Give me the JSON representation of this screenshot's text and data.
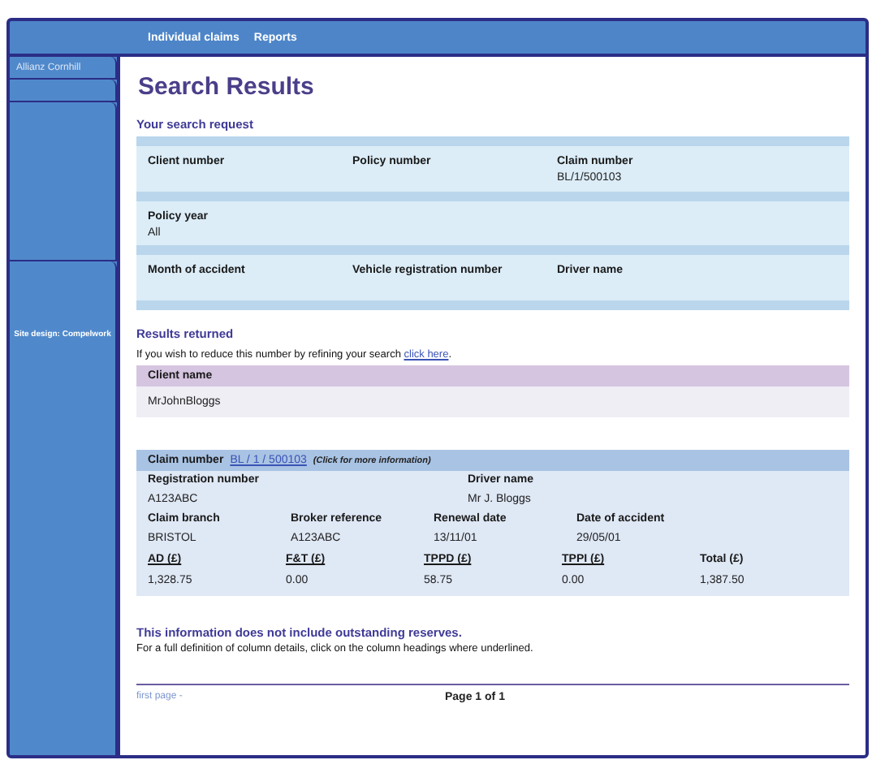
{
  "nav": [
    "Individual claims",
    "Reports"
  ],
  "sidebar": {
    "brand": "Allianz Cornhill",
    "credit": "Site design: Compelwork"
  },
  "title": "Search Results",
  "search_request": {
    "title": "Your search request",
    "rows": [
      [
        {
          "label": "Client number"
        },
        {
          "label": "Policy number"
        },
        {
          "label": "Claim number",
          "value": "BL/1/500103"
        }
      ],
      [
        {
          "label": "Policy year",
          "value": "All"
        }
      ],
      [
        {
          "label": "Month of accident"
        },
        {
          "label": "Vehicle registration number"
        },
        {
          "label": "Driver name"
        }
      ]
    ]
  },
  "results": {
    "title": "Results returned",
    "note": "If you wish to reduce this number by refining your search",
    "note_link": "click here",
    "note_end": ".",
    "client_header": "Client name",
    "client_name": "MrJohnBloggs"
  },
  "claim": {
    "label": "Claim number",
    "link": "BL / 1 / 500103",
    "hint": "(Click for more information)",
    "fields": [
      [
        {
          "label": "Registration number",
          "value": "A123ABC"
        },
        {
          "label": "Driver name",
          "value": "Mr J. Bloggs"
        }
      ],
      [
        {
          "label": "Claim branch",
          "value": "BRISTOL"
        },
        {
          "label": "Broker reference",
          "value": "A123ABC"
        },
        {
          "label": "Renewal date",
          "value": "13/11/01"
        },
        {
          "label": "Date of accident",
          "value": "29/05/01"
        }
      ]
    ],
    "amounts": [
      {
        "label": "AD (£)",
        "value": "1,328.75",
        "underlined": true
      },
      {
        "label": "F&T (£)",
        "value": "0.00",
        "underlined": true
      },
      {
        "label": "TPPD (£)",
        "value": "58.75",
        "underlined": true
      },
      {
        "label": "TPPI (£)",
        "value": "0.00",
        "underlined": true
      },
      {
        "label": "Total (£)",
        "value": "1,387.50",
        "underlined": false
      }
    ]
  },
  "footer": {
    "reserves_note": "This information does not include outstanding reserves.",
    "definition_note": "For a full definition of column details, click on the column headings where underlined.",
    "first_page": "first page -",
    "pager": "Page 1 of 1"
  }
}
